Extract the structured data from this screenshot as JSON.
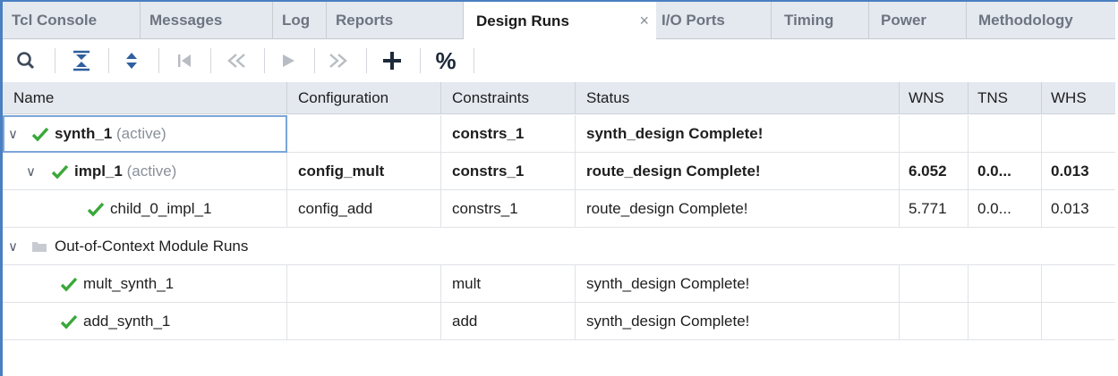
{
  "tabs": [
    {
      "label": "Tcl Console"
    },
    {
      "label": "Messages"
    },
    {
      "label": "Log"
    },
    {
      "label": "Reports"
    },
    {
      "label": "Design Runs",
      "active": true,
      "close": "×"
    },
    {
      "label": "I/O Ports"
    },
    {
      "label": "Timing"
    },
    {
      "label": "Power"
    },
    {
      "label": "Methodology"
    }
  ],
  "toolbar": {
    "buttons": [
      "search-icon",
      "collapse-all-icon",
      "expand-all-icon",
      "first-icon",
      "previous-icon",
      "play-icon",
      "next-icon",
      "add-icon",
      "percent-icon"
    ],
    "percent_label": "%"
  },
  "columns": [
    "Name",
    "Configuration",
    "Constraints",
    "Status",
    "WNS",
    "TNS",
    "WHS"
  ],
  "rows": [
    {
      "name": "synth_1",
      "suffix": "(active)",
      "config": "",
      "constraints": "constrs_1",
      "status": "synth_design Complete!",
      "wns": "",
      "tns": "",
      "whs": ""
    },
    {
      "name": "impl_1",
      "suffix": "(active)",
      "config": "config_mult",
      "constraints": "constrs_1",
      "status": "route_design Complete!",
      "wns": "6.052",
      "tns": "0.0...",
      "whs": "0.013"
    },
    {
      "name": "child_0_impl_1",
      "suffix": "",
      "config": "config_add",
      "constraints": "constrs_1",
      "status": "route_design Complete!",
      "wns": "5.771",
      "tns": "0.0...",
      "whs": "0.013"
    },
    {
      "name": "Out-of-Context Module Runs"
    },
    {
      "name": "mult_synth_1",
      "suffix": "",
      "config": "",
      "constraints": "mult",
      "status": "synth_design Complete!",
      "wns": "",
      "tns": "",
      "whs": ""
    },
    {
      "name": "add_synth_1",
      "suffix": "",
      "config": "",
      "constraints": "add",
      "status": "synth_design Complete!",
      "wns": "",
      "tns": "",
      "whs": ""
    }
  ],
  "colors": {
    "accent": "#4a7fc1",
    "check": "#3aa83a",
    "header_bg": "#e4e8ef"
  }
}
